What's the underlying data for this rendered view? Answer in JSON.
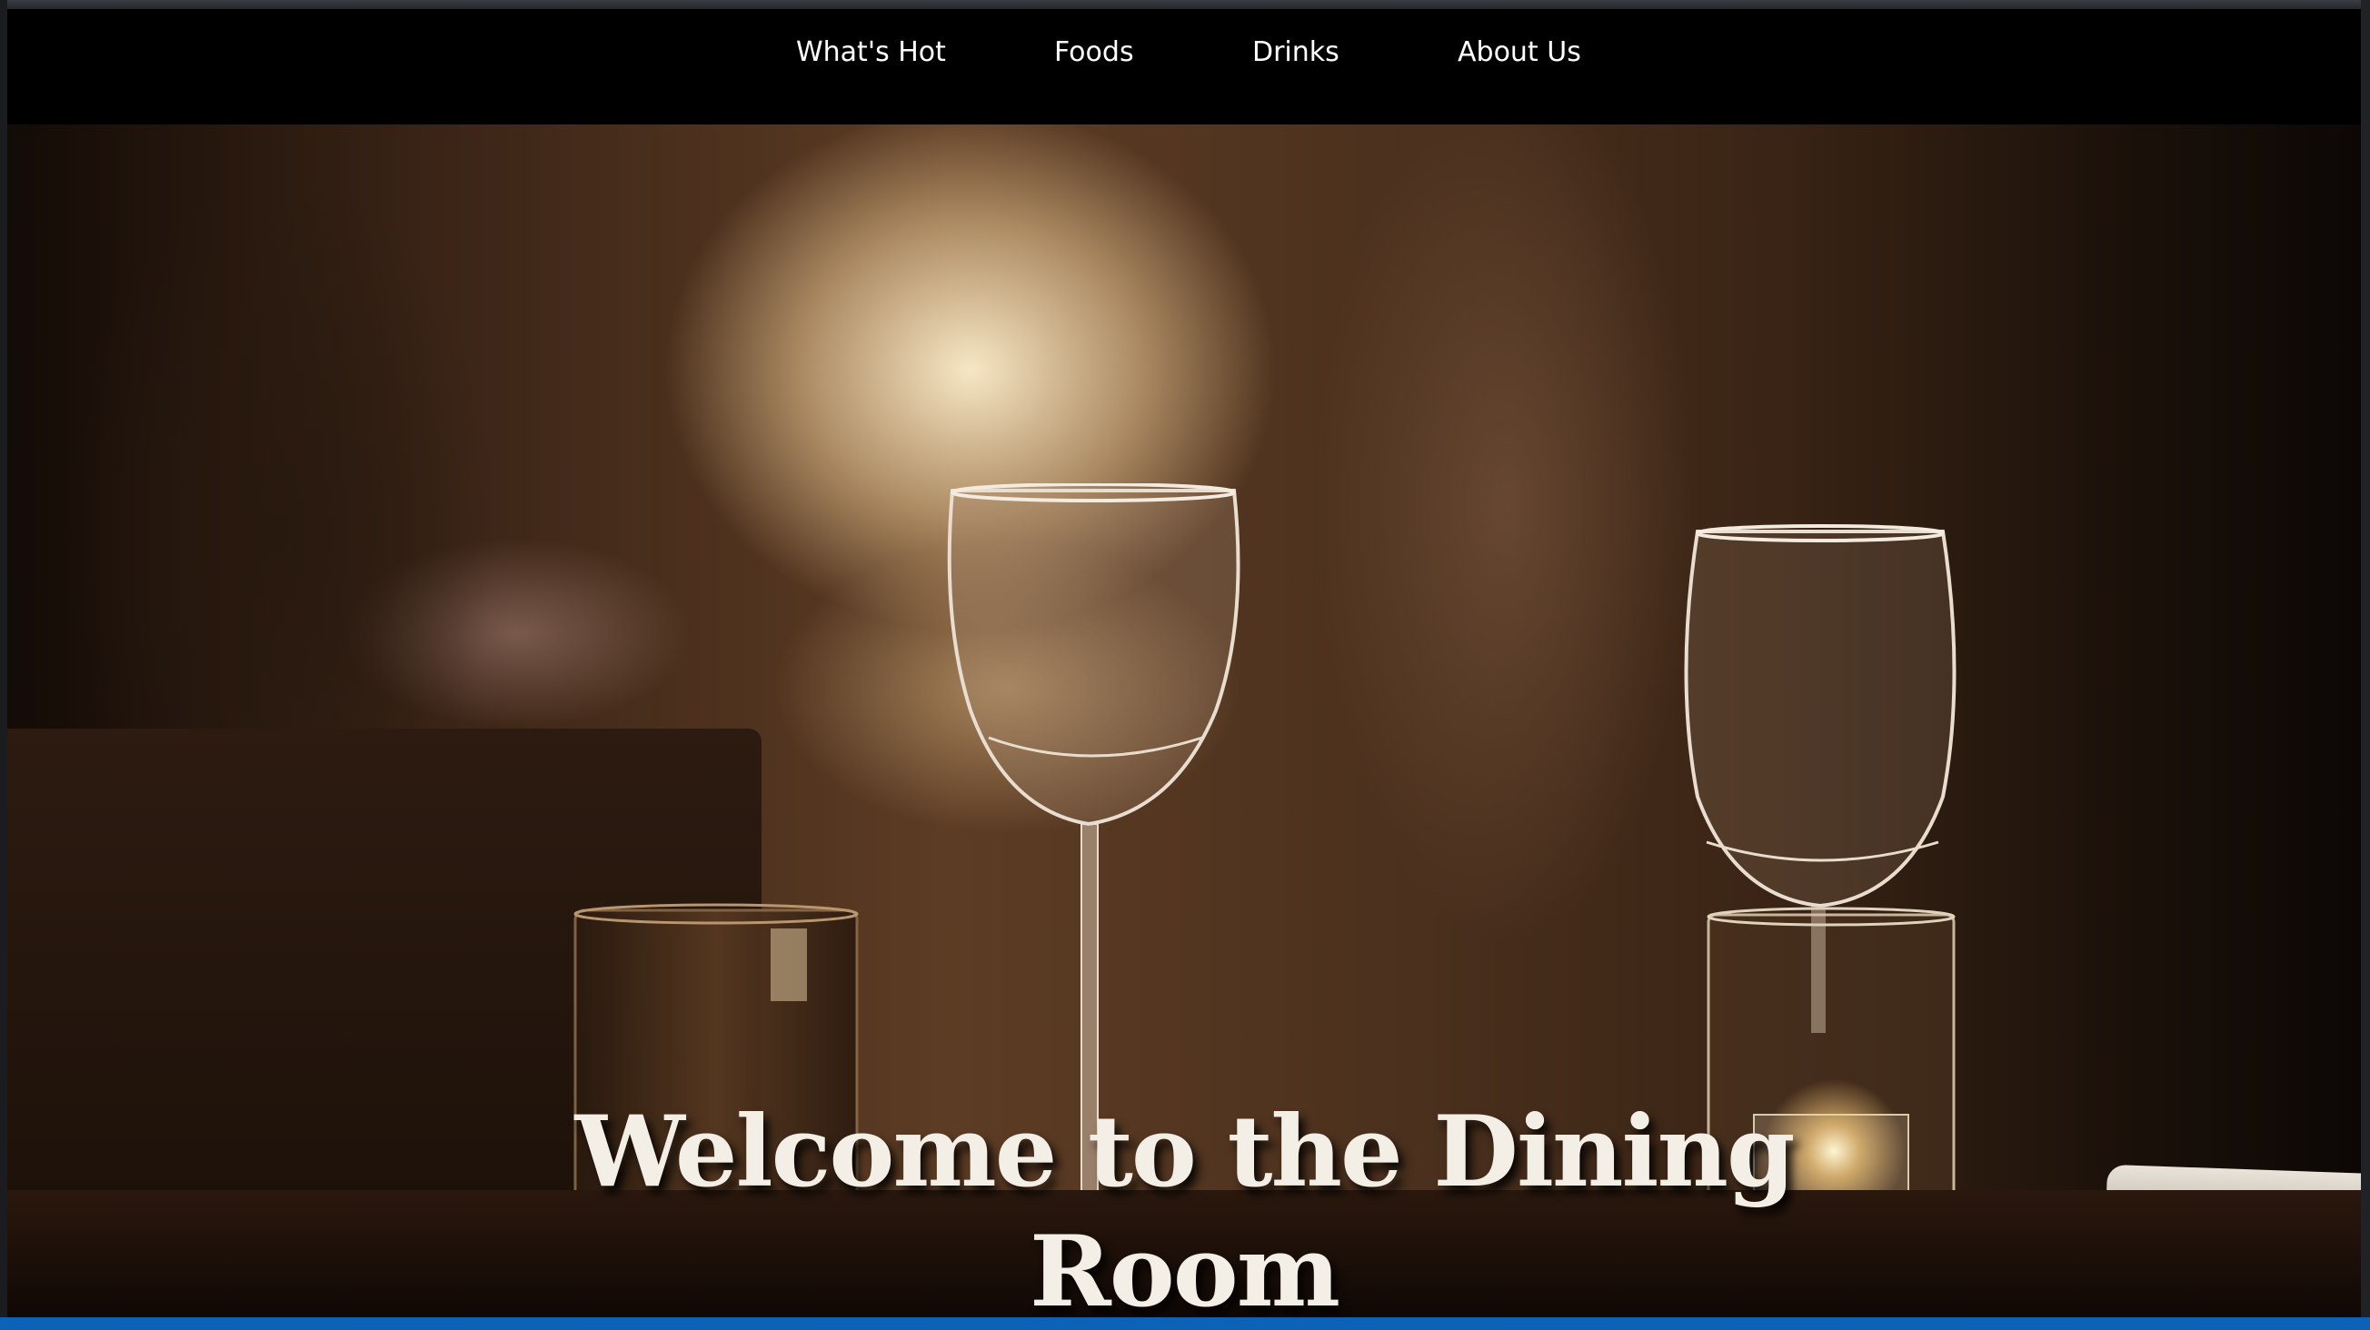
{
  "nav": {
    "items": [
      {
        "label": "What's Hot"
      },
      {
        "label": "Foods"
      },
      {
        "label": "Drinks"
      },
      {
        "label": "About Us"
      }
    ]
  },
  "hero": {
    "title_line1": "Welcome to the Dining",
    "title_line2": "Room"
  },
  "colors": {
    "nav_background": "#000000",
    "nav_text": "#ffffff",
    "hero_title": "#f4efe6",
    "status_bar": "#0b62b7"
  }
}
